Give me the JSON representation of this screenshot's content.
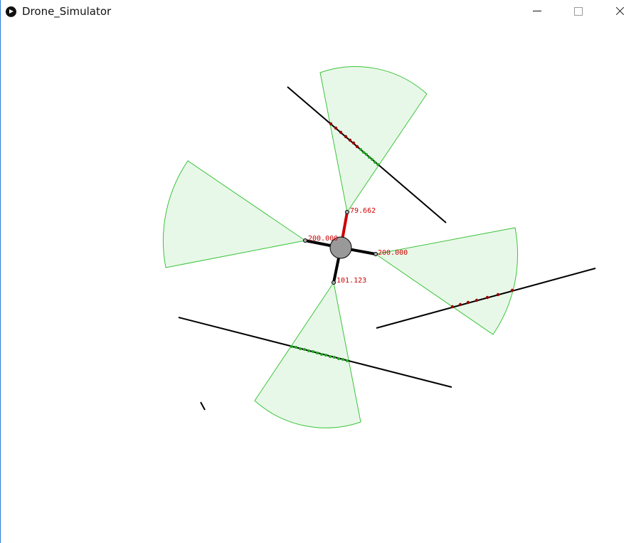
{
  "window": {
    "title": "Drone_Simulator",
    "icon": "processing-play-icon",
    "controls": [
      "minimize-icon",
      "maximize-icon",
      "close-icon"
    ]
  },
  "colors": {
    "sensor_fill": "#e8f8e8",
    "sensor_stroke": "#3ac43a",
    "hit_arm": "#cc0000",
    "arm": "#000000",
    "drone_body": "#999999",
    "reading_text": "#cc0000",
    "hit_point": "#990000",
    "near_point": "#22aa22"
  },
  "drone": {
    "sensors": [
      {
        "name": "sensor-up",
        "reading": "79.662",
        "hit": true
      },
      {
        "name": "sensor-left",
        "reading": "200.000",
        "hit": false
      },
      {
        "name": "sensor-right",
        "reading": "200.000",
        "hit": false
      },
      {
        "name": "sensor-down",
        "reading": "101.123",
        "hit": false
      }
    ]
  }
}
